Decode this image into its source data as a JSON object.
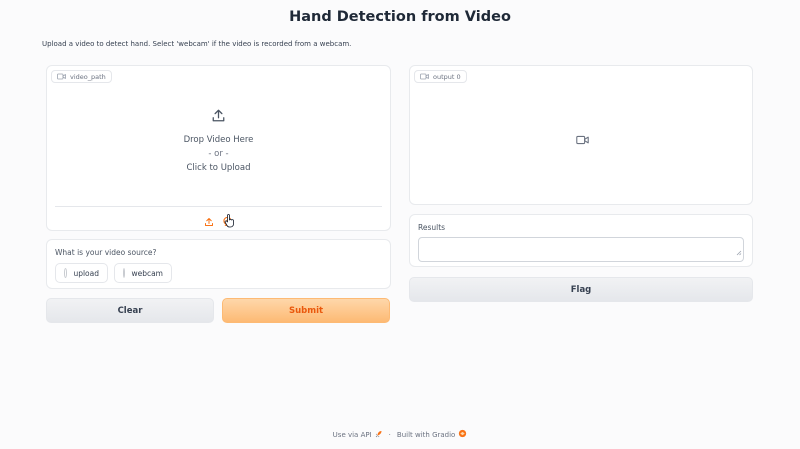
{
  "page": {
    "title": "Hand Detection from Video",
    "description": "Upload a video to detect hand. Select 'webcam' if the video is recorded from a webcam."
  },
  "input_video": {
    "label": "video_path",
    "drop_text": "Drop Video Here",
    "or_text": "- or -",
    "click_text": "Click to Upload",
    "icons": [
      "video-icon",
      "upload-icon",
      "webcam-icon"
    ]
  },
  "video_source": {
    "label": "What is your video source?",
    "options": [
      "upload",
      "webcam"
    ],
    "selected": null
  },
  "buttons": {
    "clear": "Clear",
    "submit": "Submit",
    "flag": "Flag"
  },
  "output_video": {
    "label": "output 0"
  },
  "results": {
    "label": "Results",
    "value": ""
  },
  "footer": {
    "api_text": "Use via API",
    "separator": "·",
    "built_text": "Built with Gradio"
  },
  "colors": {
    "accent": "#f97316",
    "primary_button_text": "#ea580c",
    "primary_button_bg": "#fdba74",
    "background": "#fbfbfc"
  }
}
